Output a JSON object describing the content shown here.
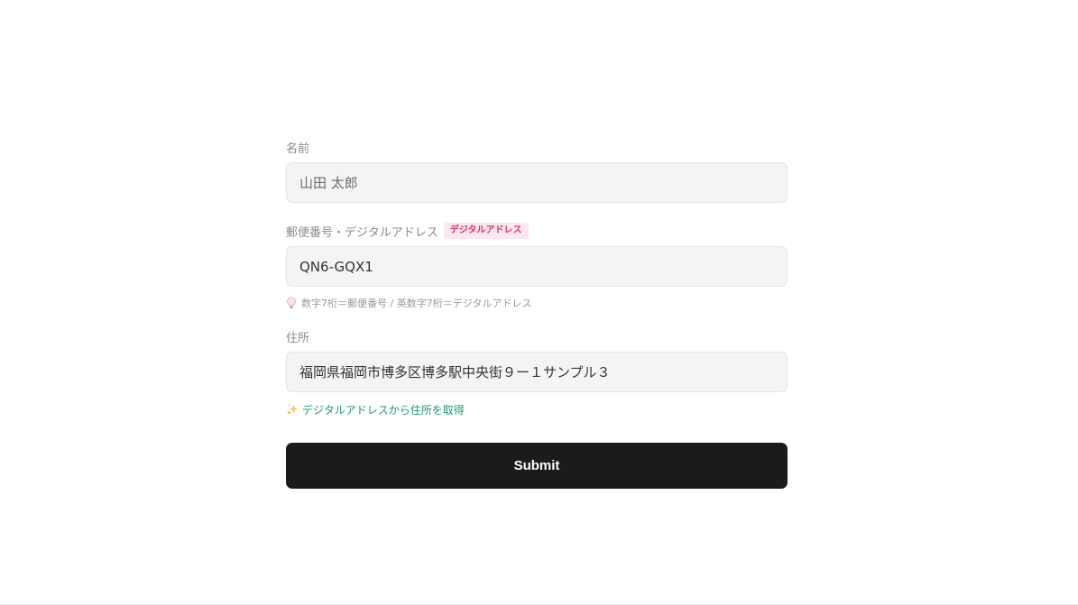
{
  "form": {
    "name": {
      "label": "名前",
      "value": "",
      "placeholder": "山田 太郎"
    },
    "postal": {
      "label": "郵便番号・デジタルアドレス",
      "badge": "デジタルアドレス",
      "value": "QN6-GQX1",
      "placeholder": "",
      "hint": "数字7桁＝郵便番号 / 英数字7桁＝デジタルアドレス",
      "hint_icon": "lightbulb-icon"
    },
    "address": {
      "label": "住所",
      "value": "福岡県福岡市博多区博多駅中央街９ー１サンプル３",
      "placeholder": "",
      "fetch_link": "デジタルアドレスから住所を取得",
      "fetch_icon": "sparkles-icon"
    },
    "submit_label": "Submit"
  },
  "colors": {
    "badge_bg": "#fde7ee",
    "badge_text": "#d6336c",
    "link": "#1e9a6e",
    "button_bg": "#1b1b1b",
    "input_bg": "#f4f4f4"
  }
}
